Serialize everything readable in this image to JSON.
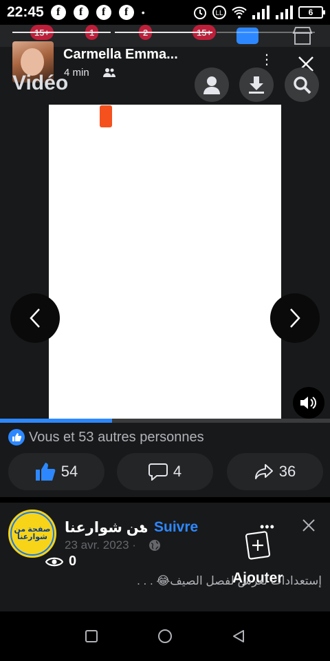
{
  "status_bar": {
    "time": "22:45",
    "fb_icons": [
      "f",
      "f",
      "f",
      "f"
    ],
    "dot": "•",
    "battery": "6"
  },
  "nav_badges": [
    "15+",
    "1",
    "2",
    "15+"
  ],
  "story": {
    "author": "Carmella Emma...",
    "time": "4 min",
    "bg_title": "Vidéo",
    "more": "⋮",
    "progress_fraction": 0.34
  },
  "reactions": {
    "summary": "Vous et 53 autres personnes",
    "likes": "54",
    "comments": "4",
    "shares": "36"
  },
  "post": {
    "page_name": "من شوارعنا",
    "avatar_text": "صفحة من شوارعنا",
    "separator": "•",
    "follow": "Suivre",
    "date": "23 avr. 2023 ·",
    "views": "0",
    "ajouter": "Ajouter",
    "ajouter_dots": "•••",
    "text": "إستعدادات لعرس لفصل الصيف😂 . . ."
  },
  "colors": {
    "accent": "#2d88ff",
    "background": "#18191a",
    "surface": "#242526",
    "badge": "#e41e3f"
  }
}
